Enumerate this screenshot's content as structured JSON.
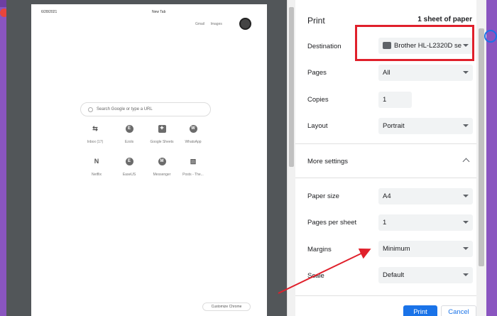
{
  "background": {
    "right_text": "st"
  },
  "preview": {
    "date": "6/28/2021",
    "tab_title": "New Tab",
    "links": [
      "Gmail",
      "Images"
    ],
    "search_placeholder": "Search Google or type a URL",
    "tiles": [
      {
        "label": "Inbox (17)",
        "icon": "inbox-icon",
        "glyph": "⇆"
      },
      {
        "label": "Ezols",
        "icon": "ezols-icon",
        "glyph": "E"
      },
      {
        "label": "Google Sheets",
        "icon": "sheets-icon",
        "glyph": "✚"
      },
      {
        "label": "WhatsApp",
        "icon": "whatsapp-icon",
        "glyph": "W"
      },
      {
        "label": "Netflix",
        "icon": "netflix-icon",
        "glyph": "N"
      },
      {
        "label": "EaseUS",
        "icon": "easeus-icon",
        "glyph": "E"
      },
      {
        "label": "Messenger",
        "icon": "messenger-icon",
        "glyph": "M"
      },
      {
        "label": "Posts - The...",
        "icon": "image-icon",
        "glyph": "▨"
      }
    ],
    "customize_label": "Customize Chrome"
  },
  "settings": {
    "title": "Print",
    "sheet_count": "1 sheet of paper",
    "destination": {
      "label": "Destination",
      "value": "Brother HL-L2320D se"
    },
    "pages": {
      "label": "Pages",
      "value": "All"
    },
    "copies": {
      "label": "Copies",
      "value": "1"
    },
    "layout": {
      "label": "Layout",
      "value": "Portrait"
    },
    "more_settings": "More settings",
    "paper_size": {
      "label": "Paper size",
      "value": "A4"
    },
    "pages_per_sheet": {
      "label": "Pages per sheet",
      "value": "1"
    },
    "margins": {
      "label": "Margins",
      "value": "Minimum"
    },
    "scale": {
      "label": "Scale",
      "value": "Default"
    },
    "print_button": "Print",
    "cancel_button": "Cancel"
  },
  "colors": {
    "annotation_red": "#e0202b",
    "accent_blue": "#1a73e8"
  }
}
